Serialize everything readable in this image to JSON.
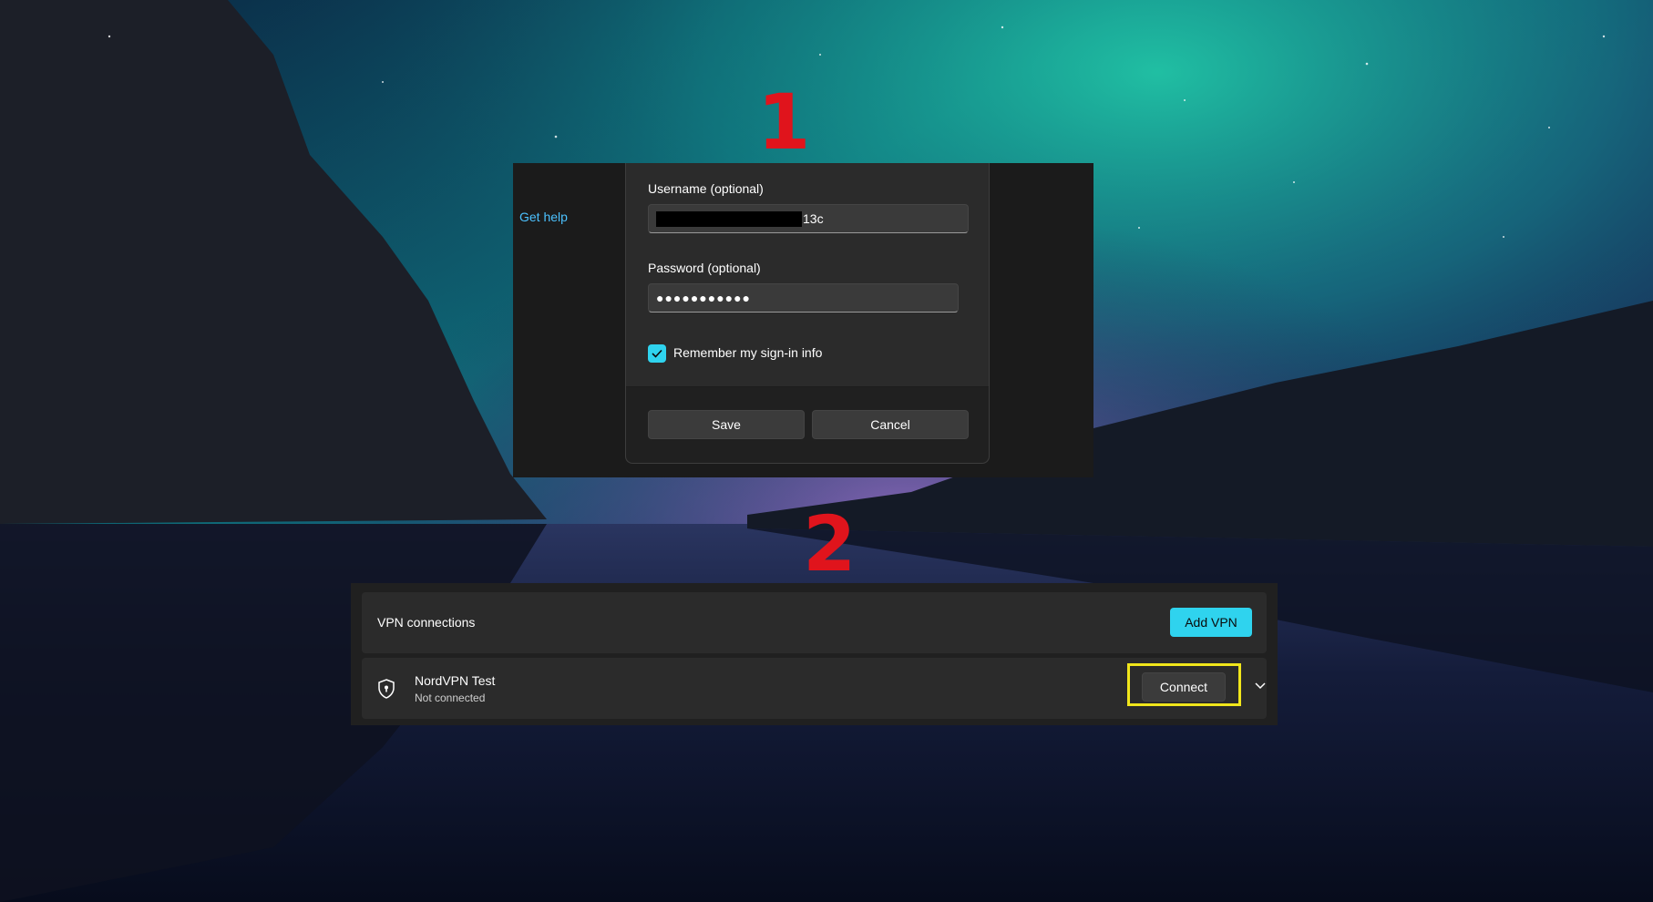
{
  "annotations": {
    "step1": "1",
    "step2": "2",
    "annotation_color": "#e0141c",
    "highlight_color": "#f1e61b"
  },
  "dialog": {
    "get_help": "Get help",
    "username_label": "Username (optional)",
    "username_value_visible": "13c",
    "password_label": "Password (optional)",
    "password_value": "●●●●●●●●●●●",
    "remember_label": "Remember my sign-in info",
    "remember_checked": true,
    "save_label": "Save",
    "cancel_label": "Cancel",
    "accent": "#2fd3ee"
  },
  "vpn": {
    "header": "VPN connections",
    "add_label": "Add VPN",
    "connection": {
      "name": "NordVPN Test",
      "status": "Not connected",
      "connect_label": "Connect",
      "icon": "shield-icon"
    }
  }
}
